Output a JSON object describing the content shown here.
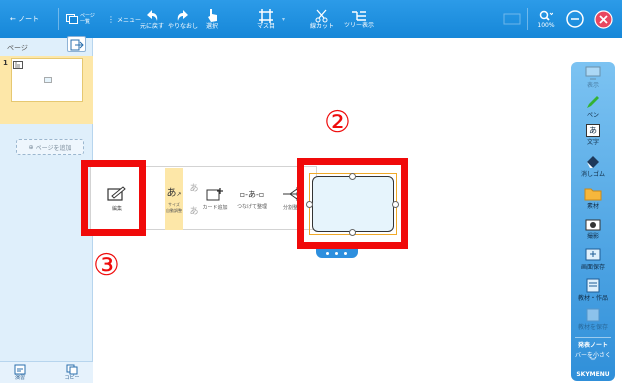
{
  "toolbar": {
    "back_label": "← ノート",
    "pages_list_label": "ページ\n一覧",
    "menu_label": "メニュー",
    "undo_label": "元に戻す",
    "redo_label": "やりなおし",
    "select_label": "選択",
    "grid_label": "マス目",
    "cut_label": "線カット",
    "tree_label": "ツリー表示",
    "zoom_label": "100%"
  },
  "left_panel": {
    "title": "ページ",
    "page_number": "1",
    "add_page_label": "ページを追加",
    "bottom_buttons": [
      {
        "label": "演習"
      },
      {
        "label": "コピー"
      }
    ]
  },
  "popup": {
    "edit_label": "編集",
    "size_label": "サイズ\n自動調整",
    "char_small": "あ",
    "char_large": "あ",
    "add_card_label": "カード追加",
    "connect_label": "つなげて整理",
    "branch_label": "分割整理"
  },
  "annotations": {
    "label_2": "②",
    "label_3": "③"
  },
  "right_panel": {
    "items": [
      {
        "label": "表示",
        "icon": "display-icon",
        "disabled": true
      },
      {
        "label": "ペン",
        "icon": "pen-icon",
        "disabled": false
      },
      {
        "label": "文字",
        "icon": "text-icon",
        "glyph": "あ",
        "disabled": false
      },
      {
        "label": "消しゴム",
        "icon": "eraser-icon",
        "disabled": false
      },
      {
        "label": "素材",
        "icon": "folder-icon",
        "disabled": false
      },
      {
        "label": "撮影",
        "icon": "camera-icon",
        "disabled": false
      },
      {
        "label": "画面保存",
        "icon": "screenshot-icon",
        "disabled": false
      },
      {
        "label": "教材・作品",
        "icon": "book-icon",
        "disabled": false
      },
      {
        "label": "教材を保存",
        "icon": "save-material-icon",
        "disabled": true
      }
    ],
    "present_label": "発表ノート",
    "shrink_label": "バーを小さく",
    "brand": "SKYMENU"
  },
  "colors": {
    "toolbar_blue": "#1687d8",
    "annotation_red": "#f00a0a",
    "page_selected": "#fde7a8",
    "object_fill": "#e6f4fc"
  }
}
